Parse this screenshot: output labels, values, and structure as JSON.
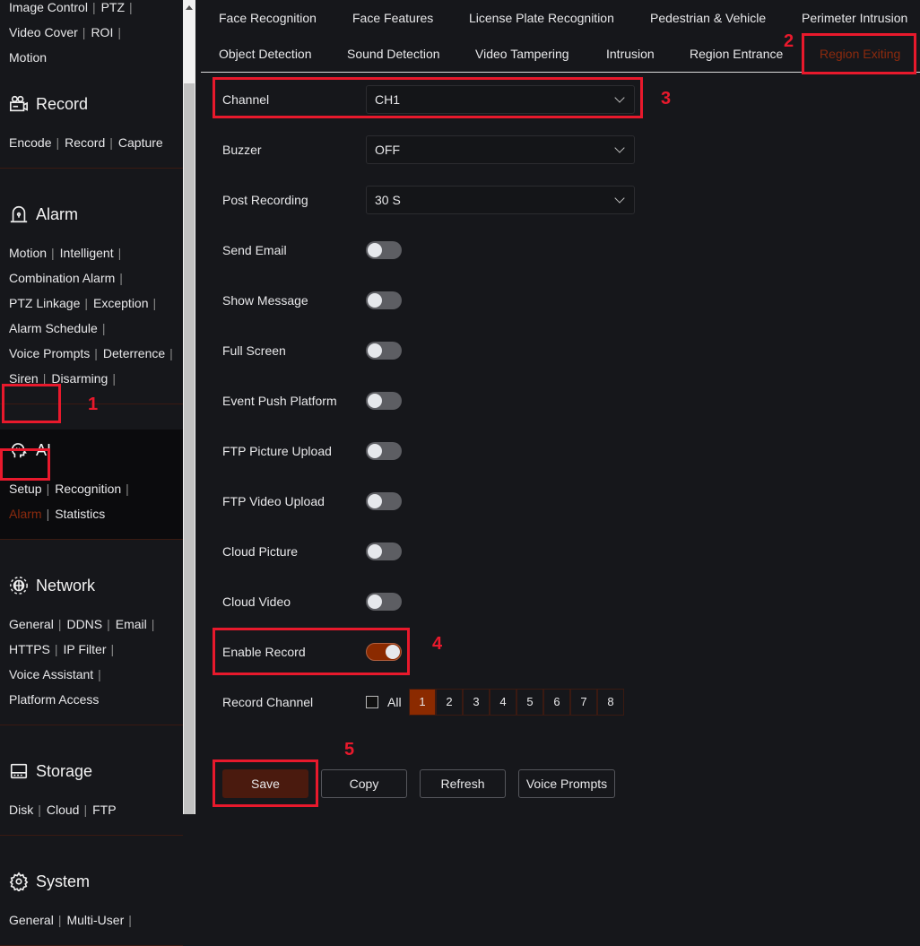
{
  "sidebar": {
    "top_links": [
      [
        "Image Control",
        "PTZ"
      ],
      [
        "Video Cover",
        "ROI"
      ],
      [
        "Motion"
      ]
    ],
    "sections": [
      {
        "title": "Record",
        "icon": "camera-icon",
        "rows": [
          [
            "Encode",
            "Record",
            "Capture"
          ]
        ]
      },
      {
        "title": "Alarm",
        "icon": "alarm-light-icon",
        "rows": [
          [
            "Motion",
            "Intelligent"
          ],
          [
            "Combination Alarm"
          ],
          [
            "PTZ Linkage",
            "Exception"
          ],
          [
            "Alarm Schedule"
          ],
          [
            "Voice Prompts",
            "Deterrence"
          ],
          [
            "Siren",
            "Disarming"
          ]
        ]
      },
      {
        "title": "AI",
        "icon": "ai-head-icon",
        "active": true,
        "rows": [
          [
            "Setup",
            "Recognition"
          ],
          [
            "Alarm",
            "Statistics"
          ]
        ],
        "selected": "Alarm"
      },
      {
        "title": "Network",
        "icon": "globe-icon",
        "rows": [
          [
            "General",
            "DDNS",
            "Email"
          ],
          [
            "HTTPS",
            "IP Filter"
          ],
          [
            "Voice Assistant"
          ],
          [
            "Platform Access"
          ]
        ]
      },
      {
        "title": "Storage",
        "icon": "hard-drive-icon",
        "rows": [
          [
            "Disk",
            "Cloud",
            "FTP"
          ]
        ]
      },
      {
        "title": "System",
        "icon": "gear-icon",
        "rows": [
          [
            "General",
            "Multi-User"
          ]
        ]
      }
    ]
  },
  "tabs": {
    "row1": [
      "Face Recognition",
      "Face Features",
      "License Plate Recognition",
      "Pedestrian & Vehicle",
      "Perimeter Intrusion"
    ],
    "row2": [
      "Object Detection",
      "Sound Detection",
      "Video Tampering",
      "Intrusion",
      "Region Entrance",
      "Region Exiting"
    ],
    "selected": "Region Exiting"
  },
  "form": {
    "channel": {
      "label": "Channel",
      "value": "CH1"
    },
    "buzzer": {
      "label": "Buzzer",
      "value": "OFF"
    },
    "post_recording": {
      "label": "Post Recording",
      "value": "30 S"
    },
    "toggles": [
      {
        "label": "Send Email",
        "on": false
      },
      {
        "label": "Show Message",
        "on": false
      },
      {
        "label": "Full Screen",
        "on": false
      },
      {
        "label": "Event Push Platform",
        "on": false
      },
      {
        "label": "FTP Picture Upload",
        "on": false
      },
      {
        "label": "FTP Video Upload",
        "on": false
      },
      {
        "label": "Cloud Picture",
        "on": false
      },
      {
        "label": "Cloud Video",
        "on": false
      },
      {
        "label": "Enable Record",
        "on": true
      }
    ],
    "record_channel": {
      "label": "Record Channel",
      "all_label": "All",
      "all_checked": false,
      "channels": [
        "1",
        "2",
        "3",
        "4",
        "5",
        "6",
        "7",
        "8"
      ],
      "selected": [
        "1"
      ]
    }
  },
  "buttons": {
    "save": "Save",
    "copy": "Copy",
    "refresh": "Refresh",
    "voice_prompts": "Voice Prompts"
  },
  "annotations": [
    "1",
    "2",
    "3",
    "4",
    "5"
  ],
  "colors": {
    "accent": "#8b2a00",
    "annotation": "#e8192c",
    "background": "#16171b"
  }
}
